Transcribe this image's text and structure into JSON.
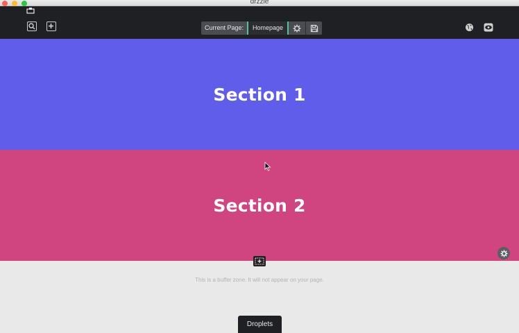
{
  "window": {
    "title": "drzzle"
  },
  "toolbar": {
    "current_page_label": "Current Page:",
    "current_page_value": "Homepage"
  },
  "sections": [
    {
      "title": "Section 1",
      "color": "#5f5de9"
    },
    {
      "title": "Section 2",
      "color": "#d04480"
    }
  ],
  "buffer": {
    "note": "This is a buffer zone. It will not appear on your page."
  },
  "droplets": {
    "label": "Droplets"
  },
  "icons": {
    "search": "search-zoom-icon",
    "add": "add-icon",
    "page_settings": "gear-icon",
    "save": "save-icon",
    "publish": "globe-icon",
    "preview": "eye-icon",
    "section_settings": "gear-icon",
    "add_section": "add-section-icon"
  },
  "colors": {
    "toolbar_bg": "#1f2023",
    "accent": "#56c19b",
    "buffer_bg": "#e9e9e9"
  }
}
